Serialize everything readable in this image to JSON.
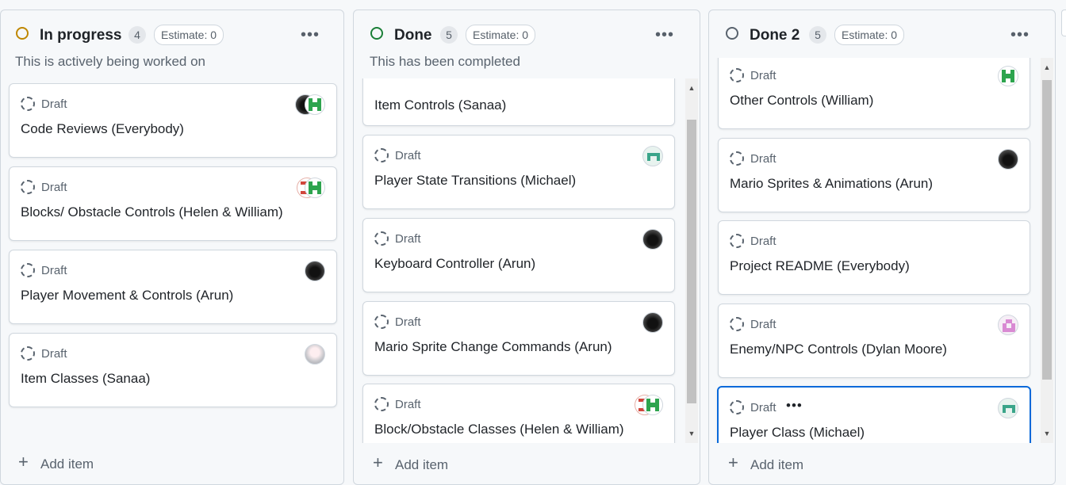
{
  "columns": [
    {
      "title": "In progress",
      "count": "4",
      "estimate": "Estimate: 0",
      "description": "This is actively being worked on",
      "status_color": "#bf8700",
      "cards": [
        {
          "status": "Draft",
          "title": "Code Reviews (Everybody)",
          "avatars": [
            "dark-avatar",
            "green-pixel-avatar"
          ]
        },
        {
          "status": "Draft",
          "title": "Blocks/ Obstacle Controls (Helen & William)",
          "avatars": [
            "red-pixel-avatar",
            "green-pixel-avatar"
          ]
        },
        {
          "status": "Draft",
          "title": "Player Movement & Controls (Arun)",
          "avatars": [
            "dark-avatar"
          ]
        },
        {
          "status": "Draft",
          "title": "Item Classes (Sanaa)",
          "avatars": [
            "anime-avatar"
          ]
        }
      ],
      "add_item": "Add item"
    },
    {
      "title": "Done",
      "count": "5",
      "estimate": "Estimate: 0",
      "description": "This has been completed",
      "status_color": "#1a7f37",
      "cards": [
        {
          "status": "Draft",
          "title": "Item Controls (Sanaa)",
          "avatars": [
            "anime-avatar"
          ]
        },
        {
          "status": "Draft",
          "title": "Player State Transitions (Michael)",
          "avatars": [
            "teal-pixel-avatar"
          ]
        },
        {
          "status": "Draft",
          "title": "Keyboard Controller (Arun)",
          "avatars": [
            "dark-avatar"
          ]
        },
        {
          "status": "Draft",
          "title": "Mario Sprite Change Commands (Arun)",
          "avatars": [
            "dark-avatar"
          ]
        },
        {
          "status": "Draft",
          "title": "Block/Obstacle Classes (Helen & William)",
          "avatars": [
            "red-pixel-avatar",
            "green-pixel-avatar"
          ]
        }
      ],
      "add_item": "Add item"
    },
    {
      "title": "Done 2",
      "count": "5",
      "estimate": "Estimate: 0",
      "description": "",
      "status_color": "#59636e",
      "cards": [
        {
          "status": "Draft",
          "title": "Other Controls (William)",
          "avatars": [
            "green-pixel-avatar"
          ]
        },
        {
          "status": "Draft",
          "title": "Mario Sprites & Animations (Arun)",
          "avatars": [
            "dark-avatar"
          ]
        },
        {
          "status": "Draft",
          "title": "Project README (Everybody)",
          "avatars": []
        },
        {
          "status": "Draft",
          "title": "Enemy/NPC Controls (Dylan Moore)",
          "avatars": [
            "pink-pixel-avatar"
          ]
        },
        {
          "status": "Draft",
          "title": "Player Class (Michael)",
          "avatars": [
            "teal-pixel-avatar"
          ],
          "menu": "•••",
          "selected": true
        }
      ],
      "add_item": "Add item"
    }
  ],
  "icons": {
    "column_menu": "•••",
    "add": "+",
    "scroll_up": "▲",
    "scroll_down": "▼"
  }
}
